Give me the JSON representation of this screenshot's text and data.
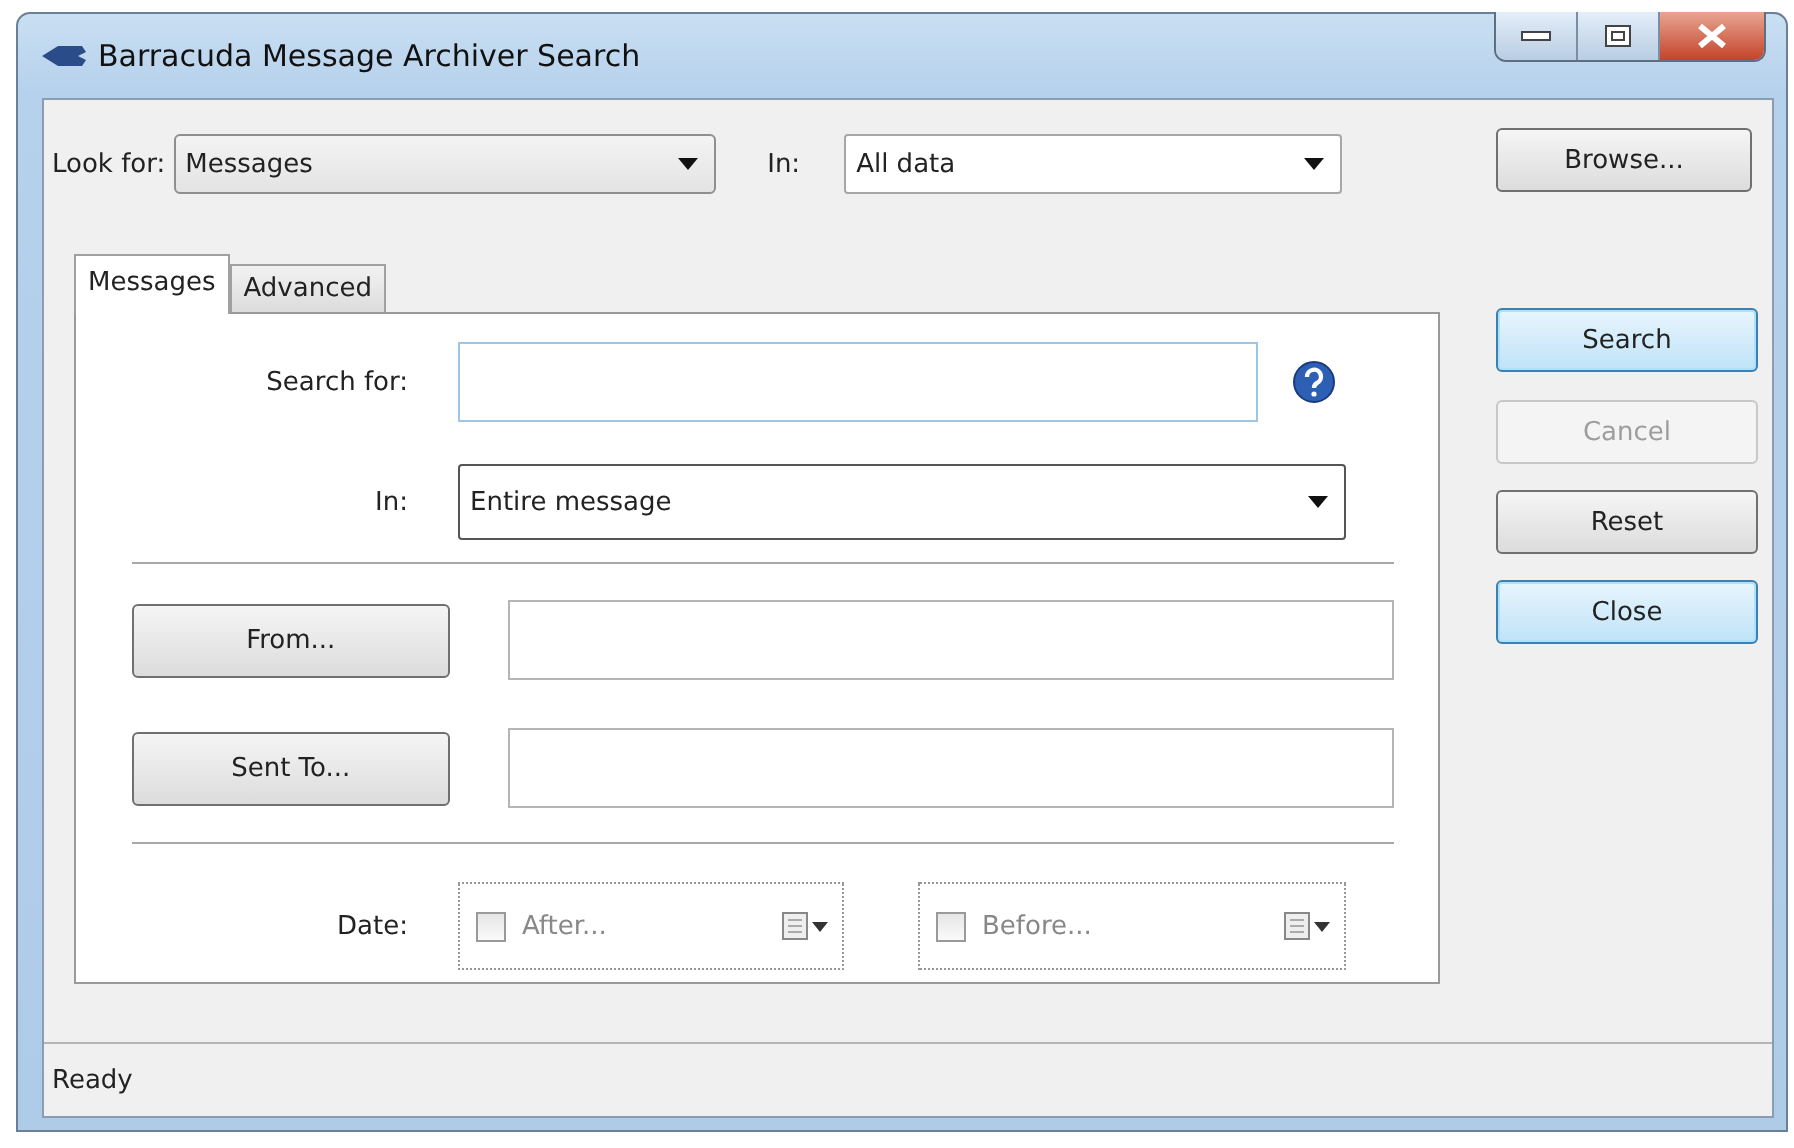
{
  "window": {
    "title": "Barracuda Message Archiver Search"
  },
  "look_for": {
    "label": "Look for:",
    "value": "Messages"
  },
  "scope": {
    "label": "In:",
    "value": "All data"
  },
  "browse_button": "Browse...",
  "tabs": [
    {
      "label": "Messages",
      "selected": true
    },
    {
      "label": "Advanced",
      "selected": false
    }
  ],
  "search_for": {
    "label": "Search for:"
  },
  "search_in": {
    "label": "In:",
    "value": "Entire message"
  },
  "from": {
    "button": "From..."
  },
  "sent_to": {
    "button": "Sent To..."
  },
  "date": {
    "label": "Date:",
    "pickers": [
      {
        "label": "After...",
        "checked": false
      },
      {
        "label": "Before...",
        "checked": false
      }
    ]
  },
  "actions": [
    {
      "label": "Search",
      "disabled": false,
      "focused": true
    },
    {
      "label": "Cancel",
      "disabled": true,
      "focused": false
    },
    {
      "label": "Reset",
      "disabled": false,
      "focused": false
    },
    {
      "label": "Close",
      "disabled": false,
      "focused": true
    }
  ],
  "status_bar": "Ready"
}
